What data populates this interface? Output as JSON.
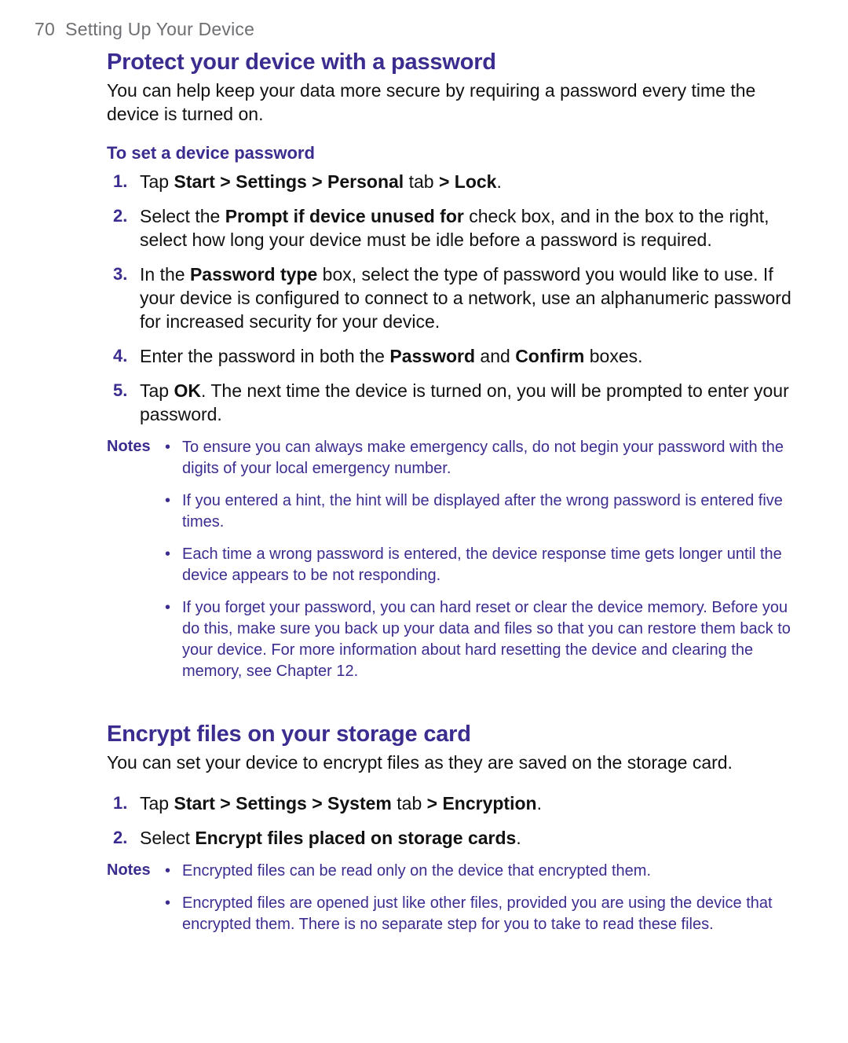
{
  "page": {
    "number": "70",
    "running_title": "Setting Up Your Device"
  },
  "section1": {
    "title": "Protect your device with a password",
    "intro": "You can help keep your data more secure by requiring a password every time the device is turned on.",
    "sub": "To set a device password",
    "steps": [
      {
        "n": "1.",
        "html": "Tap <b>Start > Settings > Personal</b> tab <b>> Lock</b>."
      },
      {
        "n": "2.",
        "html": "Select the <b>Prompt if device unused for</b> check box, and in the box to the right, select how long your device must be idle before a password is required."
      },
      {
        "n": "3.",
        "html": "In the <b>Password type</b> box, select the type of password you would like to use. If your device is configured to connect to a network, use an alphanumeric password for increased security for your device."
      },
      {
        "n": "4.",
        "html": "Enter the password in both the <b>Password</b> and <b>Confirm</b> boxes."
      },
      {
        "n": "5.",
        "html": "Tap <b>OK</b>. The next time the device is turned on, you will be prompted to enter your password."
      }
    ],
    "notes_label": "Notes",
    "notes": [
      "To ensure you can always make emergency calls, do not begin your password with the digits of your local emergency number.",
      "If you entered a hint, the hint will be displayed after the wrong password is entered five times.",
      "Each time a wrong password is entered, the device response time gets longer until the device appears to be not responding.",
      "If you forget your password, you can hard reset or clear the device memory. Before you do this, make sure you back up your data and files so that you can restore them back to your device. For more information about hard resetting the device and clearing the memory, see Chapter 12."
    ]
  },
  "section2": {
    "title": "Encrypt files on your storage card",
    "intro": "You can set your device to encrypt files as they are saved on the storage card.",
    "steps": [
      {
        "n": "1.",
        "html": "Tap <b>Start > Settings > System</b> tab <b>> Encryption</b>."
      },
      {
        "n": "2.",
        "html": "Select <b>Encrypt files placed on storage cards</b>."
      }
    ],
    "notes_label": "Notes",
    "notes": [
      "Encrypted files can be read only on the device that encrypted them.",
      "Encrypted files are opened just like other files, provided you are using the device that encrypted them. There is no separate step for you to take to read these files."
    ]
  }
}
